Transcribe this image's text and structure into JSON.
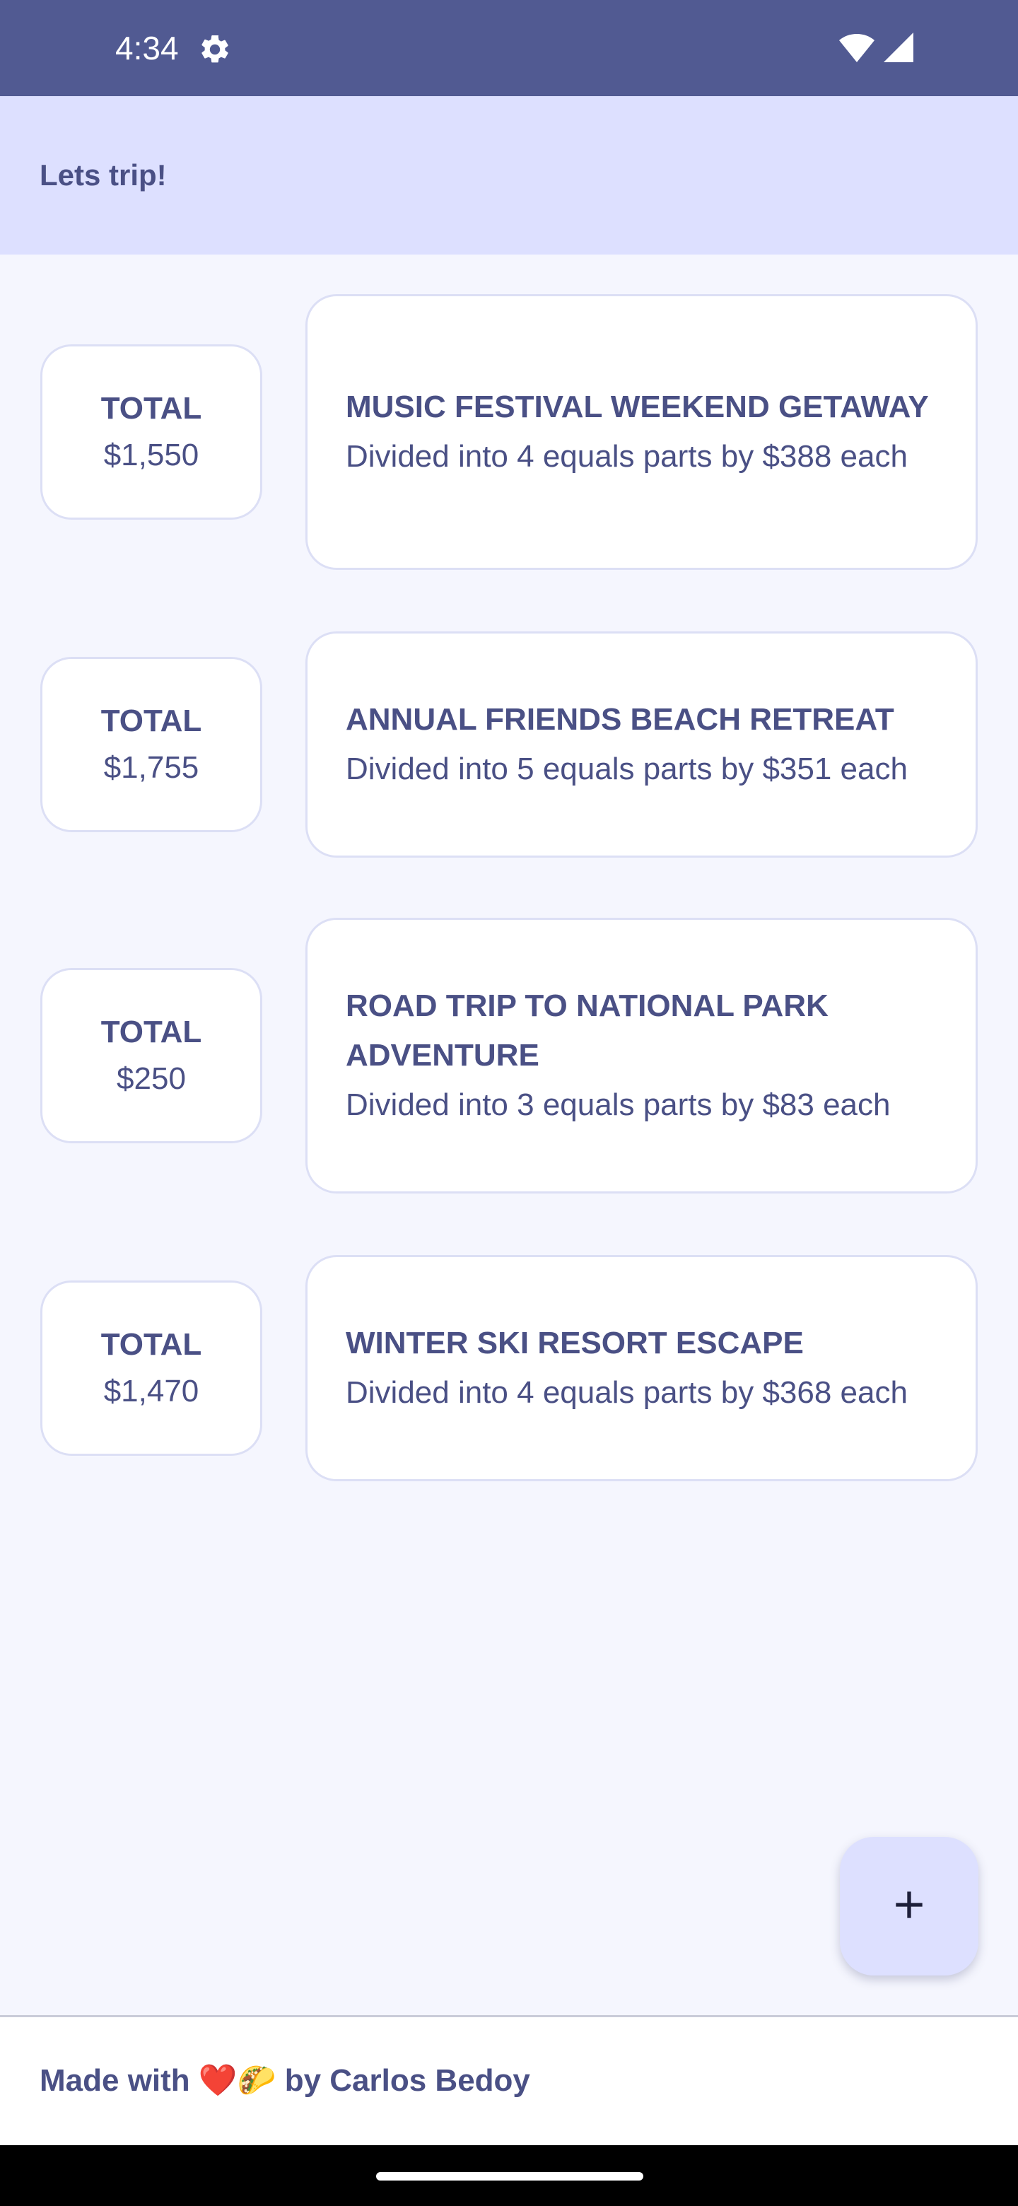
{
  "status_bar": {
    "time": "4:34",
    "icons": [
      "settings-gear-icon",
      "wifi-icon",
      "cell-signal-icon"
    ],
    "background": "#515a92"
  },
  "app_bar": {
    "title": "Lets trip!",
    "background": "#dde0ff"
  },
  "trips": [
    {
      "total_label": "TOTAL",
      "total_value": "$1,550",
      "name": "MUSIC FESTIVAL WEEKEND GETAWAY",
      "description": "Divided into 4 equals parts by $388 each"
    },
    {
      "total_label": "TOTAL",
      "total_value": "$1,755",
      "name": "ANNUAL FRIENDS BEACH RETREAT",
      "description": "Divided into 5 equals parts by $351 each"
    },
    {
      "total_label": "TOTAL",
      "total_value": "$250",
      "name": "ROAD TRIP TO NATIONAL PARK ADVENTURE",
      "description": "Divided into 3 equals parts by $83 each"
    },
    {
      "total_label": "TOTAL",
      "total_value": "$1,470",
      "name": "WINTER SKI RESORT ESCAPE",
      "description": "Divided into 4 equals parts by $368 each"
    }
  ],
  "fab": {
    "icon": "plus-icon"
  },
  "footer": {
    "text": "Made with ❤️🌮 by Carlos Bedoy"
  },
  "colors": {
    "accent": "#4a5085",
    "surface": "#f5f6fe",
    "card_border": "#dcdff5"
  }
}
